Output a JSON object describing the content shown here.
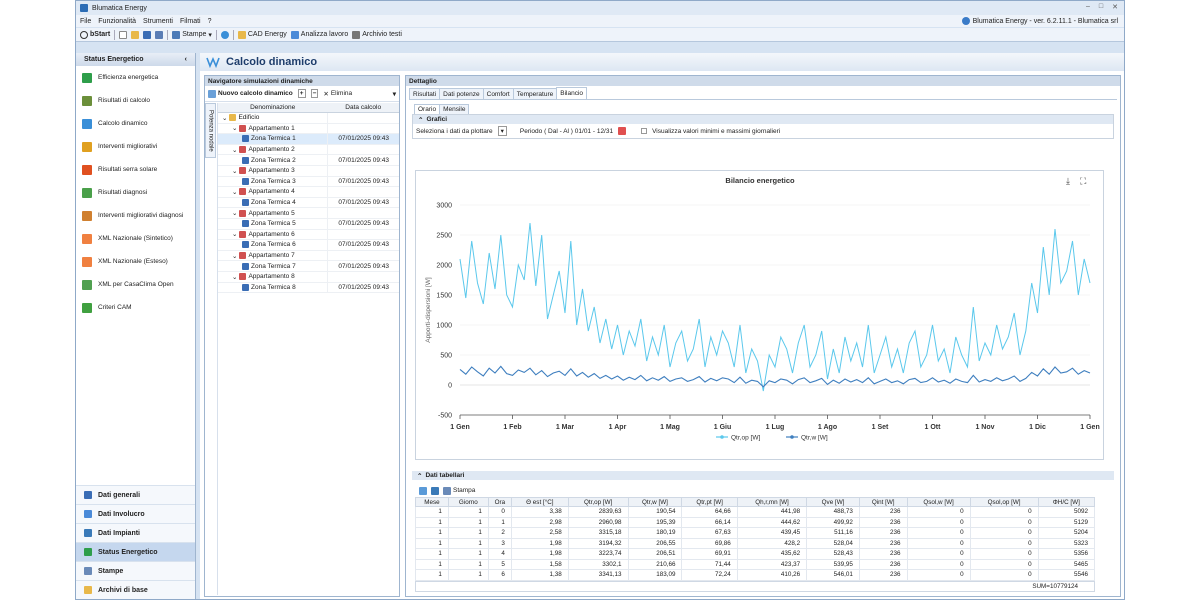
{
  "window": {
    "title": "Blumatica Energy",
    "version_text": "Blumatica Energy - ver. 6.2.11.1 - Blumatica srl"
  },
  "menu": [
    "File",
    "Funzionalità",
    "Strumenti",
    "Filmati",
    "?"
  ],
  "toolbar": {
    "start": "bStart",
    "stampe": "Stampe",
    "cad": "CAD Energy",
    "analizza": "Analizza lavoro",
    "archivio": "Archivio testi"
  },
  "sidebar": {
    "header": "Status Energetico",
    "items": [
      {
        "label": "Efficienza energetica",
        "color": "#2e9e4a"
      },
      {
        "label": "Risultati di calcolo",
        "color": "#6b8f3a"
      },
      {
        "label": "Calcolo dinamico",
        "color": "#3a8fd8"
      },
      {
        "label": "Interventi migliorativi",
        "color": "#e0a020"
      },
      {
        "label": "Risultati serra solare",
        "color": "#e05020"
      },
      {
        "label": "Risultati diagnosi",
        "color": "#4aa04a"
      },
      {
        "label": "Interventi migliorativi diagnosi",
        "color": "#d08030"
      },
      {
        "label": "XML Nazionale (Sintetico)",
        "color": "#f08040"
      },
      {
        "label": "XML Nazionale (Esteso)",
        "color": "#f08040"
      },
      {
        "label": "XML per CasaClima Open",
        "color": "#50a050"
      },
      {
        "label": "Criteri CAM",
        "color": "#40a040"
      }
    ],
    "nav": [
      "Dati generali",
      "Dati Involucro",
      "Dati Impianti",
      "Status Energetico",
      "Stampe",
      "Archivi di base"
    ]
  },
  "main": {
    "title": "Calcolo dinamico"
  },
  "navigator": {
    "title": "Navigatore simulazioni dinamiche",
    "new_label": "Nuovo calcolo dinamico",
    "delete_label": "Elimina",
    "side_tab": "Potenza nodale",
    "col_name": "Denominazione",
    "col_date": "Data calcolo",
    "rows": [
      {
        "name": "Edificio",
        "date": "",
        "level": 0
      },
      {
        "name": "Appartamento 1",
        "date": "",
        "level": 1
      },
      {
        "name": "Zona Termica 1",
        "date": "07/01/2025 09:43",
        "level": 2
      },
      {
        "name": "Appartamento 2",
        "date": "",
        "level": 1
      },
      {
        "name": "Zona Termica 2",
        "date": "07/01/2025 09:43",
        "level": 2
      },
      {
        "name": "Appartamento 3",
        "date": "",
        "level": 1
      },
      {
        "name": "Zona Termica 3",
        "date": "07/01/2025 09:43",
        "level": 2
      },
      {
        "name": "Appartamento 4",
        "date": "",
        "level": 1
      },
      {
        "name": "Zona Termica 4",
        "date": "07/01/2025 09:43",
        "level": 2
      },
      {
        "name": "Appartamento 5",
        "date": "",
        "level": 1
      },
      {
        "name": "Zona Termica 5",
        "date": "07/01/2025 09:43",
        "level": 2
      },
      {
        "name": "Appartamento 6",
        "date": "",
        "level": 1
      },
      {
        "name": "Zona Termica 6",
        "date": "07/01/2025 09:43",
        "level": 2
      },
      {
        "name": "Appartamento 7",
        "date": "",
        "level": 1
      },
      {
        "name": "Zona Termica 7",
        "date": "07/01/2025 09:43",
        "level": 2
      },
      {
        "name": "Appartamento 8",
        "date": "",
        "level": 1
      },
      {
        "name": "Zona Termica 8",
        "date": "07/01/2025 09:43",
        "level": 2
      }
    ]
  },
  "detail": {
    "title": "Dettaglio",
    "tabs": [
      "Risultati",
      "Dati potenze",
      "Comfort",
      "Temperature",
      "Bilancio"
    ],
    "subtabs": [
      "Orario",
      "Mensile"
    ],
    "grafici_label": "Grafici",
    "select_label": "Seleziona i dati da plottare",
    "period_label": "Periodo ( Dal - Al ) 01/01 - 12/31",
    "minmax_label": "Visualizza valori minimi e massimi giornalieri",
    "tabellari_label": "Dati tabellari",
    "stampa_label": "Stampa"
  },
  "chart_data": {
    "type": "line",
    "title": "Bilancio energetico",
    "ylabel": "Apporti-dispersioni [W]",
    "ylim": [
      -500,
      3000
    ],
    "yticks": [
      "3000",
      "2500",
      "2000",
      "1500",
      "1000",
      "500",
      "0",
      "-500"
    ],
    "xticks": [
      "1 Gen",
      "1 Feb",
      "1 Mar",
      "1 Apr",
      "1 Mag",
      "1 Giu",
      "1 Lug",
      "1 Ago",
      "1 Set",
      "1 Ott",
      "1 Nov",
      "1 Dic",
      "1 Gen"
    ],
    "series": [
      {
        "name": "Qtr,op [W]",
        "color": "#5bc8ec",
        "values": [
          2100,
          1450,
          2400,
          1700,
          1350,
          2200,
          1600,
          2500,
          1500,
          1300,
          2000,
          1750,
          2700,
          1650,
          2500,
          1100,
          1500,
          1900,
          1200,
          2400,
          1000,
          1600,
          900,
          1300,
          700,
          1100,
          600,
          1000,
          500,
          900,
          650,
          1100,
          400,
          800,
          500,
          1000,
          300,
          700,
          900,
          400,
          600,
          1100,
          300,
          800,
          500,
          900,
          700,
          300,
          1000,
          200,
          600,
          400,
          -100,
          500,
          300,
          800,
          600,
          200,
          700,
          1000,
          300,
          500,
          900,
          100,
          600,
          200,
          800,
          400,
          700,
          300,
          1000,
          200,
          500,
          800,
          300,
          600,
          200,
          700,
          900,
          300,
          500,
          1000,
          400,
          600,
          200,
          800,
          500,
          300,
          1300,
          400,
          700,
          500,
          1000,
          600,
          800,
          1200,
          500,
          900,
          1700,
          1200,
          2300,
          1500,
          2600,
          1700,
          1900,
          2400,
          1500,
          2100,
          1700
        ]
      },
      {
        "name": "Qtr,w [W]",
        "color": "#3f7fbf",
        "values": [
          260,
          180,
          300,
          220,
          150,
          280,
          200,
          310,
          190,
          160,
          250,
          210,
          280,
          170,
          240,
          140,
          200,
          230,
          160,
          270,
          150,
          210,
          130,
          190,
          110,
          160,
          100,
          150,
          80,
          130,
          90,
          160,
          70,
          120,
          80,
          140,
          60,
          100,
          120,
          60,
          90,
          140,
          50,
          110,
          70,
          120,
          100,
          40,
          130,
          30,
          80,
          60,
          -30,
          70,
          40,
          100,
          80,
          20,
          90,
          120,
          40,
          70,
          110,
          10,
          80,
          30,
          100,
          50,
          90,
          40,
          120,
          20,
          60,
          100,
          40,
          70,
          20,
          90,
          110,
          40,
          60,
          120,
          50,
          80,
          30,
          100,
          60,
          40,
          160,
          50,
          90,
          60,
          120,
          70,
          100,
          150,
          60,
          110,
          210,
          150,
          270,
          180,
          300,
          200,
          220,
          280,
          180,
          240,
          200
        ]
      }
    ]
  },
  "table": {
    "columns": [
      "Mese",
      "Giorno",
      "Ora",
      "Θ est [°C]",
      "Qtr,op [W]",
      "Qtr,w [W]",
      "Qtr,pt [W]",
      "Qh,r,mn [W]",
      "Qve [W]",
      "Qint [W]",
      "Qsol,w [W]",
      "Qsol,op [W]",
      "ΦH/C [W]"
    ],
    "rows": [
      [
        "1",
        "1",
        "0",
        "3,38",
        "2839,63",
        "190,54",
        "64,66",
        "441,98",
        "488,73",
        "236",
        "0",
        "0",
        "5092"
      ],
      [
        "1",
        "1",
        "1",
        "2,98",
        "2960,98",
        "195,39",
        "66,14",
        "444,62",
        "499,92",
        "236",
        "0",
        "0",
        "5129"
      ],
      [
        "1",
        "1",
        "2",
        "2,58",
        "3315,18",
        "180,19",
        "67,63",
        "439,45",
        "511,16",
        "236",
        "0",
        "0",
        "5204"
      ],
      [
        "1",
        "1",
        "3",
        "1,98",
        "3194,32",
        "206,55",
        "69,86",
        "428,2",
        "528,04",
        "236",
        "0",
        "0",
        "5323"
      ],
      [
        "1",
        "1",
        "4",
        "1,98",
        "3223,74",
        "206,51",
        "69,91",
        "435,62",
        "528,43",
        "236",
        "0",
        "0",
        "5356"
      ],
      [
        "1",
        "1",
        "5",
        "1,58",
        "3302,1",
        "210,66",
        "71,44",
        "423,37",
        "539,95",
        "236",
        "0",
        "0",
        "5465"
      ],
      [
        "1",
        "1",
        "6",
        "1,38",
        "3341,13",
        "183,09",
        "72,24",
        "410,26",
        "546,01",
        "236",
        "0",
        "0",
        "5546"
      ]
    ],
    "sum": "SUM=10779124"
  }
}
